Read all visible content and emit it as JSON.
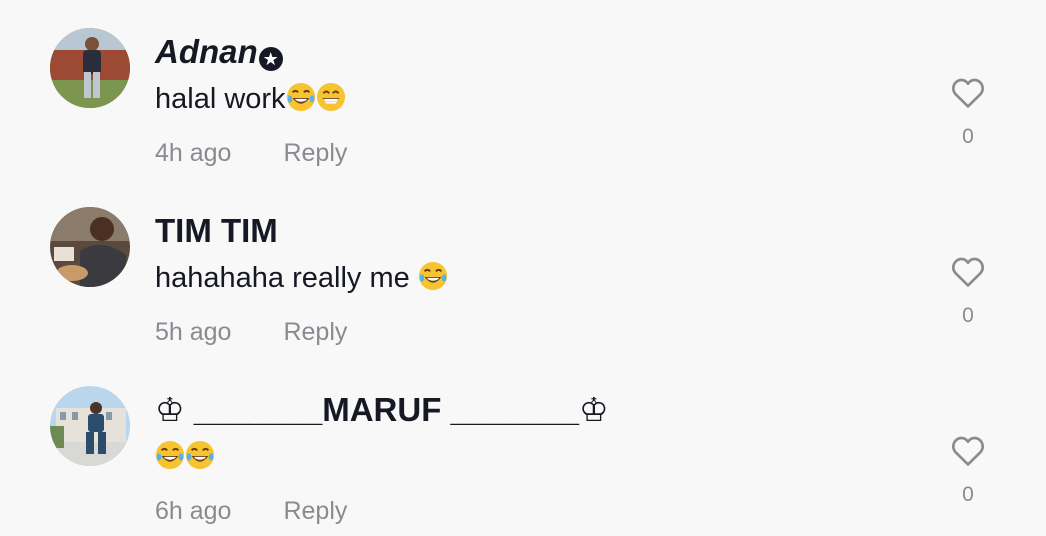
{
  "comments": [
    {
      "username": "Adnan",
      "username_badge": "★",
      "text": "halal work",
      "emojis": [
        "tears-of-joy-emoji",
        "grinning-emoji"
      ],
      "time": "4h ago",
      "reply_label": "Reply",
      "like_count": "0"
    },
    {
      "username": "TIM TIM",
      "text": "hahahaha really me ",
      "emojis": [
        "tears-of-joy-emoji"
      ],
      "time": "5h ago",
      "reply_label": "Reply",
      "like_count": "0"
    },
    {
      "username": "♔ _______MARUF _______♔",
      "text": "",
      "emojis": [
        "tears-of-joy-emoji",
        "tears-of-joy-emoji"
      ],
      "time": "6h ago",
      "reply_label": "Reply",
      "like_count": "0"
    }
  ],
  "colors": {
    "background": "#f8f8f8",
    "username": "#161823",
    "meta": "#8a8b91"
  },
  "icons": [
    "heart-outline-icon",
    "avatar"
  ]
}
